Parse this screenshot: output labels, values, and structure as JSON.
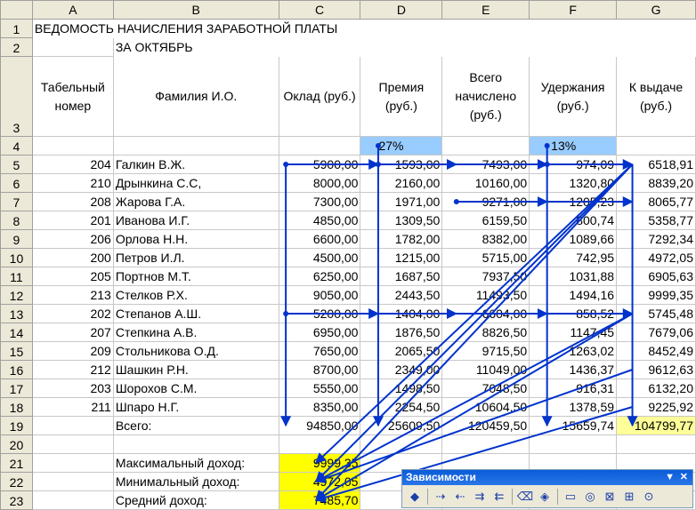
{
  "columns": [
    "A",
    "B",
    "C",
    "D",
    "E",
    "F",
    "G"
  ],
  "title": "ВЕДОМОСТЬ НАЧИСЛЕНИЯ ЗАРАБОТНОЙ ПЛАТЫ",
  "subtitle": "ЗА ОКТЯБРЬ",
  "headers": {
    "tab": "Табельный номер",
    "name": "Фамилия И.О.",
    "salary": "Оклад (руб.)",
    "bonus": "Премия (руб.)",
    "total": "Всего начислено (руб.)",
    "deduct": "Удержания (руб.)",
    "payout": "К выдаче (руб.)"
  },
  "bonus_pct": "27%",
  "deduct_pct": "13%",
  "rows": [
    {
      "row": "5",
      "tab": "204",
      "name": "Галкин В.Ж.",
      "salary": "5900,00",
      "bonus": "1593,00",
      "total": "7493,00",
      "deduct": "974,09",
      "payout": "6518,91"
    },
    {
      "row": "6",
      "tab": "210",
      "name": "Дрынкина С.С,",
      "salary": "8000,00",
      "bonus": "2160,00",
      "total": "10160,00",
      "deduct": "1320,80",
      "payout": "8839,20"
    },
    {
      "row": "7",
      "tab": "208",
      "name": "Жарова Г.А.",
      "salary": "7300,00",
      "bonus": "1971,00",
      "total": "9271,00",
      "deduct": "1205,23",
      "payout": "8065,77"
    },
    {
      "row": "8",
      "tab": "201",
      "name": "Иванова И.Г.",
      "salary": "4850,00",
      "bonus": "1309,50",
      "total": "6159,50",
      "deduct": "800,74",
      "payout": "5358,77"
    },
    {
      "row": "9",
      "tab": "206",
      "name": "Орлова Н.Н.",
      "salary": "6600,00",
      "bonus": "1782,00",
      "total": "8382,00",
      "deduct": "1089,66",
      "payout": "7292,34"
    },
    {
      "row": "10",
      "tab": "200",
      "name": "Петров И.Л.",
      "salary": "4500,00",
      "bonus": "1215,00",
      "total": "5715,00",
      "deduct": "742,95",
      "payout": "4972,05"
    },
    {
      "row": "11",
      "tab": "205",
      "name": "Портнов М.Т.",
      "salary": "6250,00",
      "bonus": "1687,50",
      "total": "7937,50",
      "deduct": "1031,88",
      "payout": "6905,63"
    },
    {
      "row": "12",
      "tab": "213",
      "name": "Стелков Р.Х.",
      "salary": "9050,00",
      "bonus": "2443,50",
      "total": "11493,50",
      "deduct": "1494,16",
      "payout": "9999,35"
    },
    {
      "row": "13",
      "tab": "202",
      "name": "Степанов А.Ш.",
      "salary": "5200,00",
      "bonus": "1404,00",
      "total": "6604,00",
      "deduct": "858,52",
      "payout": "5745,48"
    },
    {
      "row": "14",
      "tab": "207",
      "name": "Степкина А.В.",
      "salary": "6950,00",
      "bonus": "1876,50",
      "total": "8826,50",
      "deduct": "1147,45",
      "payout": "7679,06"
    },
    {
      "row": "15",
      "tab": "209",
      "name": "Стольникова О.Д.",
      "salary": "7650,00",
      "bonus": "2065,50",
      "total": "9715,50",
      "deduct": "1263,02",
      "payout": "8452,49"
    },
    {
      "row": "16",
      "tab": "212",
      "name": "Шашкин Р.Н.",
      "salary": "8700,00",
      "bonus": "2349,00",
      "total": "11049,00",
      "deduct": "1436,37",
      "payout": "9612,63"
    },
    {
      "row": "17",
      "tab": "203",
      "name": "Шорохов С.М.",
      "salary": "5550,00",
      "bonus": "1498,50",
      "total": "7048,50",
      "deduct": "916,31",
      "payout": "6132,20"
    },
    {
      "row": "18",
      "tab": "211",
      "name": "Шпаро Н.Г.",
      "salary": "8350,00",
      "bonus": "2254,50",
      "total": "10604,50",
      "deduct": "1378,59",
      "payout": "9225,92"
    }
  ],
  "totals": {
    "label": "Всего:",
    "salary": "94850,00",
    "bonus": "25609,50",
    "total": "120459,50",
    "deduct": "15659,74",
    "payout": "104799,77"
  },
  "summary": [
    {
      "label": "Максимальный доход:",
      "value": "9999,35"
    },
    {
      "label": "Минимальный доход:",
      "value": "4972,05"
    },
    {
      "label": "Средний доход:",
      "value": "7485,70"
    }
  ],
  "toolbar": {
    "title": "Зависимости",
    "icons": [
      "select-precedents-icon",
      "trace-precedents-icon",
      "remove-precedents-icon",
      "trace-dependents-icon",
      "remove-dependents-icon",
      "remove-all-arrows-icon",
      "trace-error-icon",
      "new-comment-icon",
      "circle-invalid-icon",
      "clear-validation-icon",
      "show-watch-icon",
      "evaluate-formula-icon"
    ]
  },
  "colors": {
    "accent_blue": "#0033cc",
    "input_cell": "#99ccff",
    "highlight": "#ffff00"
  }
}
